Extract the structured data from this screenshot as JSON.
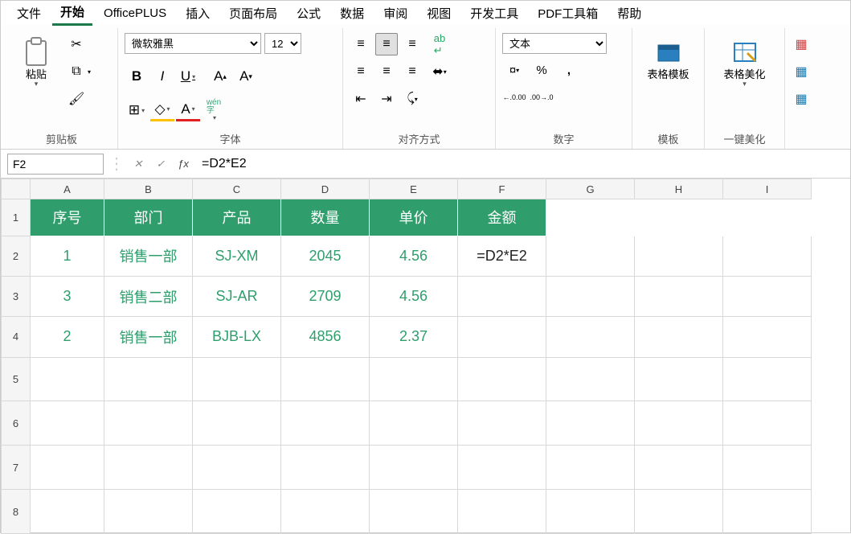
{
  "menu": {
    "items": [
      "文件",
      "开始",
      "OfficePLUS",
      "插入",
      "页面布局",
      "公式",
      "数据",
      "审阅",
      "视图",
      "开发工具",
      "PDF工具箱",
      "帮助"
    ],
    "active_index": 1
  },
  "ribbon": {
    "clipboard": {
      "label": "剪贴板",
      "paste": "粘贴"
    },
    "font": {
      "label": "字体",
      "name": "微软雅黑",
      "size": "12",
      "pinyin": "wén\n字"
    },
    "alignment": {
      "label": "对齐方式"
    },
    "number": {
      "label": "数字",
      "format": "文本",
      "inc": ".00→.0",
      "dec": "←.0.00"
    },
    "template": {
      "label": "模板",
      "btn": "表格模板"
    },
    "beautify": {
      "label": "一键美化",
      "btn": "表格美化"
    }
  },
  "formula_bar": {
    "name_box": "F2",
    "formula": "=D2*E2"
  },
  "sheet": {
    "columns": [
      "A",
      "B",
      "C",
      "D",
      "E",
      "F",
      "G",
      "H",
      "I"
    ],
    "row_numbers": [
      1,
      2,
      3,
      4,
      5,
      6,
      7,
      8
    ],
    "headers": [
      "序号",
      "部门",
      "产品",
      "数量",
      "单价",
      "金额"
    ],
    "rows": [
      {
        "seq": "1",
        "dept": "销售一部",
        "product": "SJ-XM",
        "qty": "2045",
        "price": "4.56",
        "amount": "=D2*E2"
      },
      {
        "seq": "3",
        "dept": "销售二部",
        "product": "SJ-AR",
        "qty": "2709",
        "price": "4.56",
        "amount": ""
      },
      {
        "seq": "2",
        "dept": "销售一部",
        "product": "BJB-LX",
        "qty": "4856",
        "price": "2.37",
        "amount": ""
      }
    ]
  }
}
